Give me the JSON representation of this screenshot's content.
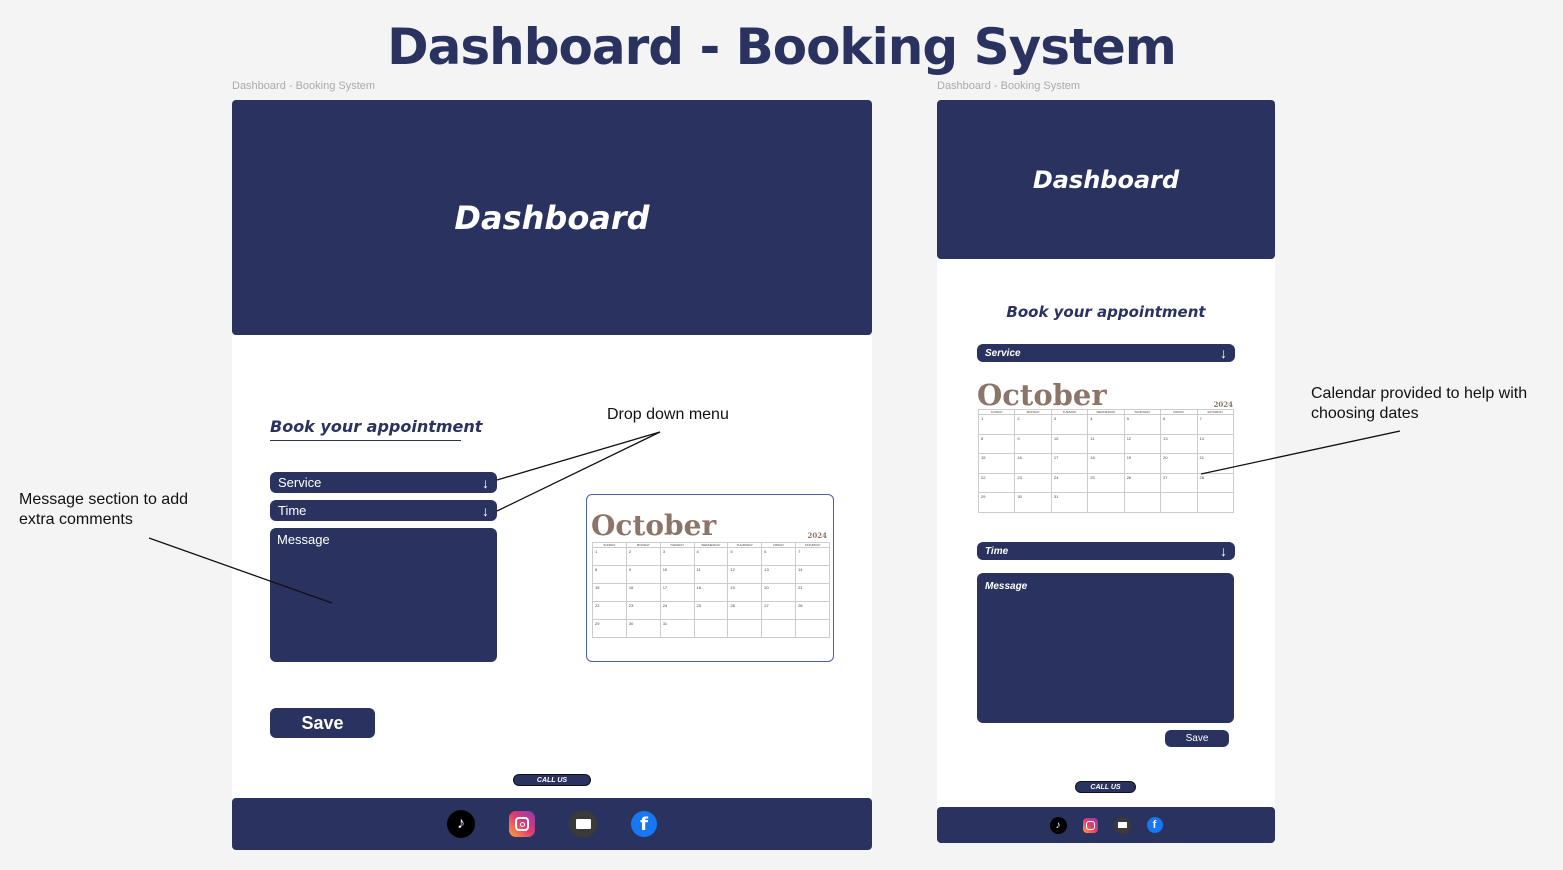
{
  "page": {
    "title": "Dashboard - Booking System"
  },
  "desktop": {
    "frame_label": "Dashboard - Booking System",
    "hero_title": "Dashboard",
    "book_title": "Book your appointment",
    "service_label": "Service",
    "time_label": "Time",
    "message_label": "Message",
    "save_label": "Save",
    "call_us_label": "CALL US"
  },
  "mobile": {
    "frame_label": "Dashboard - Booking System",
    "hero_title": "Dashboard",
    "book_title": "Book your appointment",
    "service_label": "Service",
    "time_label": "Time",
    "message_label": "Message",
    "save_label": "Save",
    "call_us_label": "CALL US"
  },
  "calendar": {
    "month": "October",
    "year": "2024",
    "weekdays": [
      "SUNDAY",
      "MONDAY",
      "TUESDAY",
      "WEDNESDAY",
      "THURSDAY",
      "FRIDAY",
      "SATURDAY"
    ],
    "weeks": [
      [
        "1",
        "2",
        "3",
        "4",
        "5",
        "6",
        "7"
      ],
      [
        "8",
        "9",
        "10",
        "11",
        "12",
        "13",
        "14"
      ],
      [
        "15",
        "16",
        "17",
        "18",
        "19",
        "20",
        "21"
      ],
      [
        "22",
        "23",
        "24",
        "25",
        "26",
        "27",
        "28"
      ],
      [
        "29",
        "30",
        "31",
        "",
        "",
        "",
        ""
      ]
    ]
  },
  "annotations": {
    "dropdown": "Drop down menu",
    "message": "Message section to add extra comments",
    "calendar": "Calendar provided to help with choosing dates"
  },
  "social_icons": [
    "tiktok-icon",
    "instagram-icon",
    "email-icon",
    "facebook-icon"
  ],
  "colors": {
    "navy": "#2a3360",
    "month_brown": "#8b7468",
    "background": "#f4f4f4"
  }
}
